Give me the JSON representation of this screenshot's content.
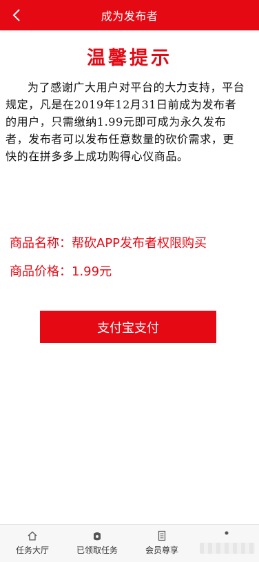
{
  "header": {
    "title": "成为发布者",
    "back_icon": "back-chevron-icon"
  },
  "notice": {
    "title": "温馨提示",
    "body": "为了感谢广大用户对平台的大力支持，平台规定，凡是在2019年12月31日前成为发布者的用户，只需缴纳1.99元即可成为永久发布者，发布者可以发布任意数量的砍价需求，更快的在拼多多上成功购得心仪商品。"
  },
  "product": {
    "name_line": "商品名称：帮砍APP发布者权限购买",
    "price_line": "商品价格：1.99元"
  },
  "pay_button": {
    "label": "支付宝支付"
  },
  "tabbar": {
    "items": [
      {
        "label": "任务大厅",
        "icon": "home-icon"
      },
      {
        "label": "已领取任务",
        "icon": "task-bag-icon"
      },
      {
        "label": "会员尊享",
        "icon": "document-icon"
      },
      {
        "label": "",
        "icon": "profile-icon"
      }
    ]
  },
  "colors": {
    "brand_red": "#e50914"
  }
}
